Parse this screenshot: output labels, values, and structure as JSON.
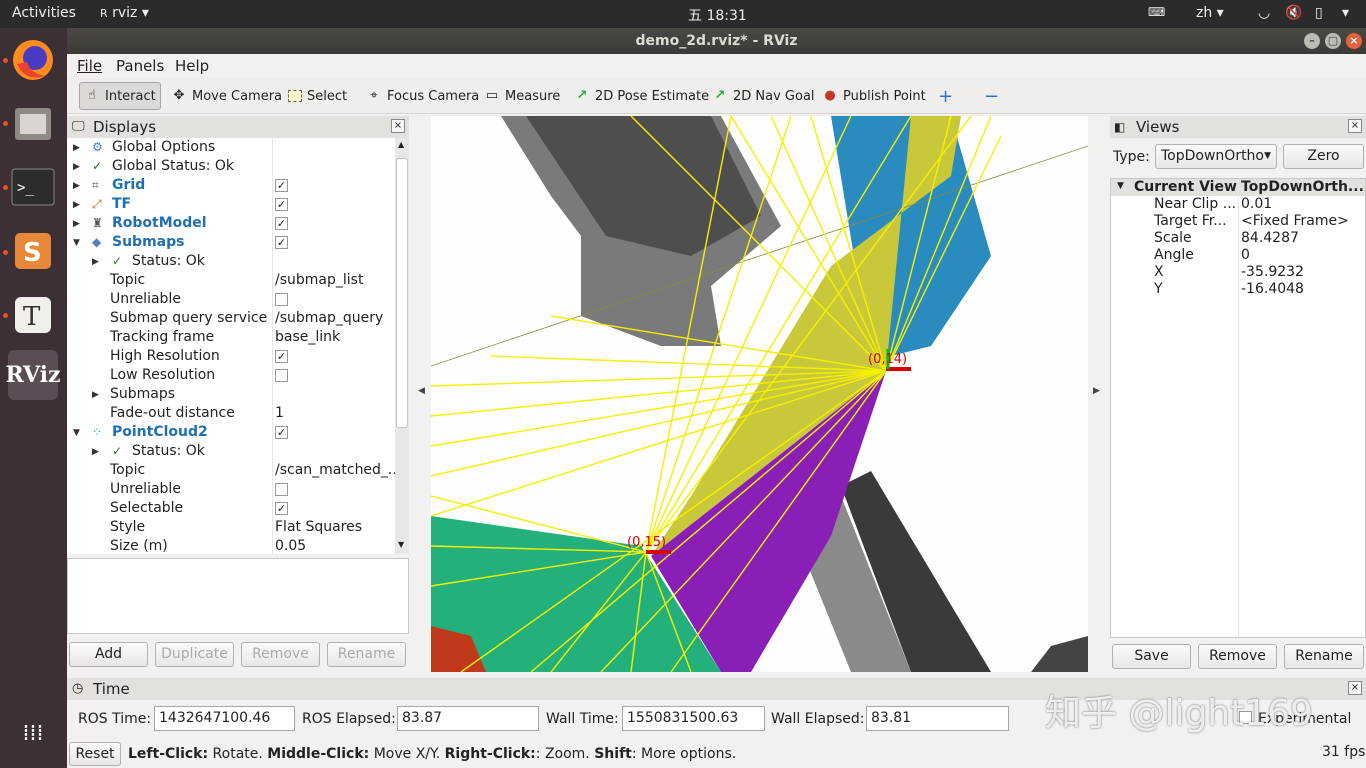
{
  "topbar": {
    "activities": "Activities",
    "app_name": "rviz",
    "clock": "五 18:31",
    "lang": "zh"
  },
  "window": {
    "title": "demo_2d.rviz* - RViz"
  },
  "menu": [
    "File",
    "Panels",
    "Help"
  ],
  "toolbar": {
    "interact": "Interact",
    "move_camera": "Move Camera",
    "select": "Select",
    "focus_camera": "Focus Camera",
    "measure": "Measure",
    "pose_estimate": "2D Pose Estimate",
    "nav_goal": "2D Nav Goal",
    "publish_point": "Publish Point"
  },
  "displays": {
    "title": "Displays",
    "rows": [
      {
        "name": "Global Options",
        "value": ""
      },
      {
        "name": "Global Status: Ok",
        "value": ""
      },
      {
        "name": "Grid",
        "value": ""
      },
      {
        "name": "TF",
        "value": ""
      },
      {
        "name": "RobotModel",
        "value": ""
      },
      {
        "name": "Submaps",
        "value": ""
      },
      {
        "name": "Status: Ok",
        "value": ""
      },
      {
        "name": "Topic",
        "value": "/submap_list"
      },
      {
        "name": "Unreliable",
        "value": ""
      },
      {
        "name": "Submap query service",
        "value": "/submap_query"
      },
      {
        "name": "Tracking frame",
        "value": "base_link"
      },
      {
        "name": "High Resolution",
        "value": ""
      },
      {
        "name": "Low Resolution",
        "value": ""
      },
      {
        "name": "Submaps",
        "value": ""
      },
      {
        "name": "Fade-out distance",
        "value": "1"
      },
      {
        "name": "PointCloud2",
        "value": ""
      },
      {
        "name": "Status: Ok",
        "value": ""
      },
      {
        "name": "Topic",
        "value": "/scan_matched_..."
      },
      {
        "name": "Unreliable",
        "value": ""
      },
      {
        "name": "Selectable",
        "value": ""
      },
      {
        "name": "Style",
        "value": "Flat Squares"
      },
      {
        "name": "Size (m)",
        "value": "0.05"
      }
    ],
    "buttons": {
      "add": "Add",
      "duplicate": "Duplicate",
      "remove": "Remove",
      "rename": "Rename"
    }
  },
  "viewport": {
    "label_a": "(0,14)",
    "label_b": "(0,15)"
  },
  "views": {
    "title": "Views",
    "type_label": "Type:",
    "type_value": "TopDownOrtho",
    "zero": "Zero",
    "current_view": "Current View",
    "current_view_value": "TopDownOrth...",
    "props": [
      {
        "k": "Near Clip ...",
        "v": "0.01"
      },
      {
        "k": "Target Fr...",
        "v": "<Fixed Frame>"
      },
      {
        "k": "Scale",
        "v": "84.4287"
      },
      {
        "k": "Angle",
        "v": "0"
      },
      {
        "k": "X",
        "v": "-35.9232"
      },
      {
        "k": "Y",
        "v": "-16.4048"
      }
    ],
    "buttons": {
      "save": "Save",
      "remove": "Remove",
      "rename": "Rename"
    }
  },
  "time": {
    "title": "Time",
    "ros_time_label": "ROS Time:",
    "ros_time": "1432647100.46",
    "ros_elapsed_label": "ROS Elapsed:",
    "ros_elapsed": "83.87",
    "wall_time_label": "Wall Time:",
    "wall_time": "1550831500.63",
    "wall_elapsed_label": "Wall Elapsed:",
    "wall_elapsed": "83.81",
    "experimental": "Experimental",
    "watermark": "知乎 @light169"
  },
  "status": {
    "reset": "Reset",
    "help_b1": "Left-Click:",
    "help_t1": " Rotate. ",
    "help_b2": "Middle-Click:",
    "help_t2": " Move X/Y. ",
    "help_b3": "Right-Click:",
    "help_t3": ": Zoom. ",
    "help_b4": "Shift",
    "help_t4": ": More options.",
    "fps": "31 fps"
  }
}
